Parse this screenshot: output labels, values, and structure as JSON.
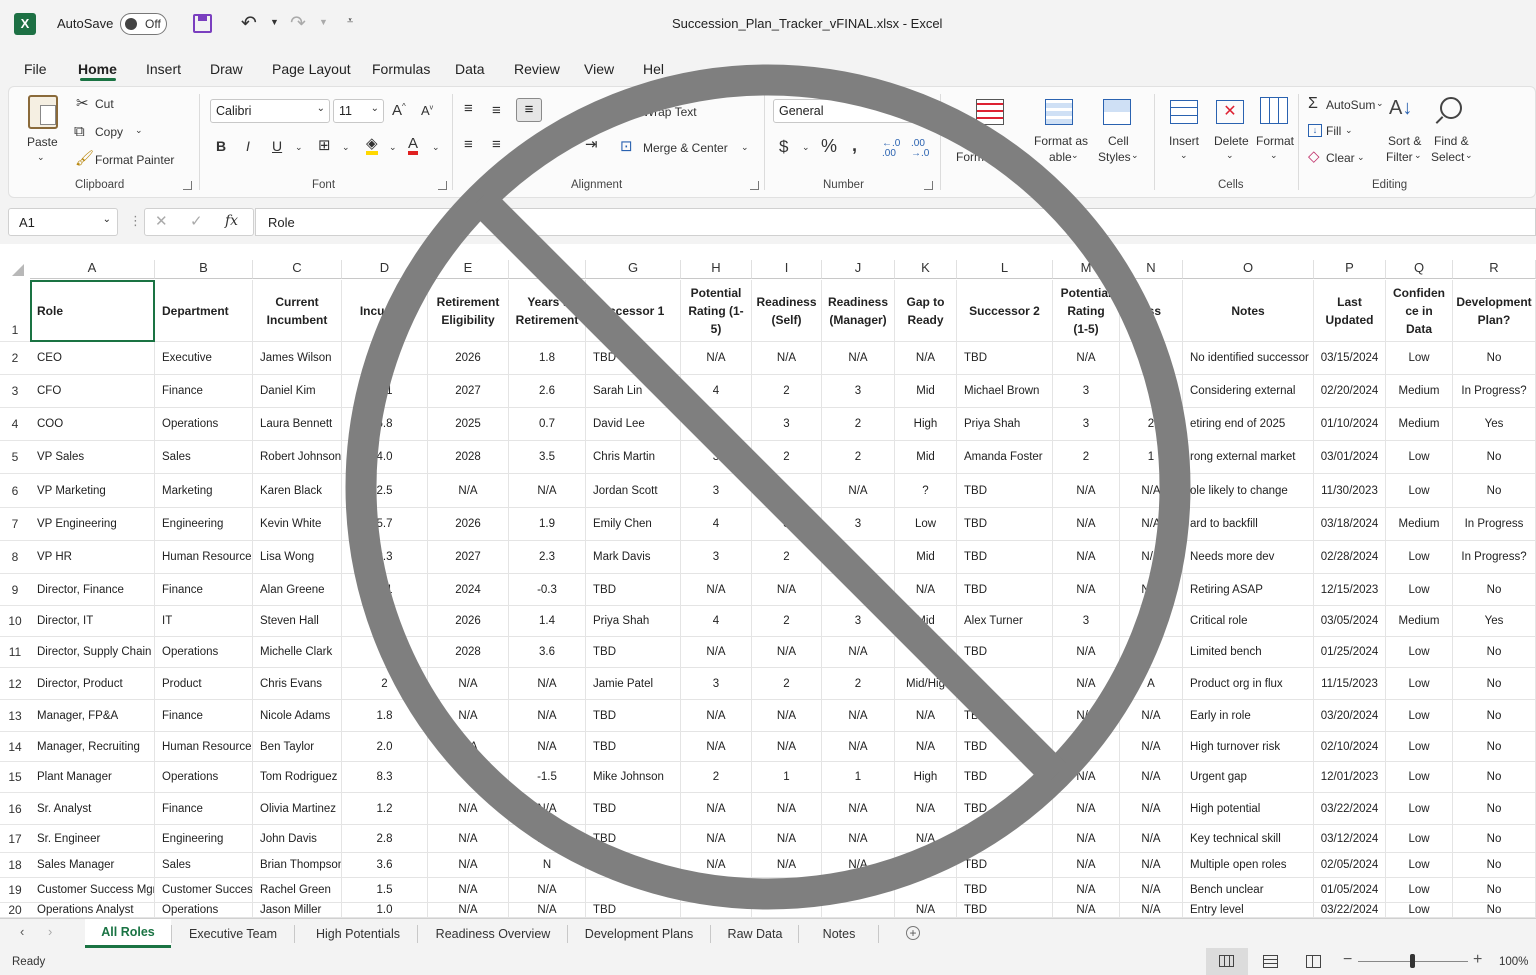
{
  "app": {
    "title": "Succession_Plan_Tracker_vFINAL.xlsx - Excel",
    "autosave_label": "AutoSave",
    "autosave_state": "Off",
    "accent": "#1a7343"
  },
  "menu": {
    "items": [
      "File",
      "Home",
      "Insert",
      "Draw",
      "Page Layout",
      "Formulas",
      "Data",
      "Review",
      "View",
      "Hel"
    ],
    "active": "Home"
  },
  "ribbon": {
    "clipboard": {
      "paste": "Paste",
      "cut": "Cut",
      "copy": "Copy",
      "format_painter": "Format Painter",
      "group": "Clipboard"
    },
    "font": {
      "name": "Calibri",
      "size": "11",
      "group": "Font"
    },
    "alignment": {
      "wrap": "Wrap Text",
      "merge": "Merge & Center",
      "group": "Alignment"
    },
    "number": {
      "format": "General",
      "group": "Number"
    },
    "styles": {
      "cond1": "Con",
      "cond2": "Formatti",
      "fmt_table1": "Format as",
      "fmt_table2": "able",
      "cell_styles1": "Cell",
      "cell_styles2": "Styles"
    },
    "cells": {
      "insert": "Insert",
      "delete": "Delete",
      "format": "Format",
      "group": "Cells"
    },
    "editing": {
      "autosum": "AutoSum",
      "fill": "Fill",
      "clear": "Clear",
      "sort1": "Sort &",
      "sort2": "Filter",
      "find1": "Find &",
      "find2": "Select",
      "group": "Editing"
    }
  },
  "formula_bar": {
    "name_box": "A1",
    "fx": "fx",
    "value": "Role"
  },
  "grid": {
    "columns": [
      "A",
      "B",
      "C",
      "D",
      "E",
      "",
      "G",
      "H",
      "I",
      "J",
      "K",
      "L",
      "M",
      "N",
      "O",
      "P",
      "Q",
      "R"
    ],
    "header_row": [
      "Role",
      "Department",
      "Current Incumbent",
      "Incu T s)",
      "Retirement Eligibility",
      "Years t Retirement",
      "uccessor 1",
      "Potential Rating (1-5)",
      "Readiness (Self)",
      "Readiness (Manager)",
      "Gap to Ready",
      "Successor 2",
      "Potential Rating (1-5)",
      "ess",
      "Notes",
      "Last Updated",
      "Confiden ce in Data",
      "Development Plan?"
    ],
    "rows": [
      [
        "2",
        "CEO",
        "Executive",
        "James Wilson",
        "2",
        "2026",
        "1.8",
        "TBD",
        "N/A",
        "N/A",
        "N/A",
        "N/A",
        "TBD",
        "N/A",
        "N/",
        "No identified successor",
        "03/15/2024",
        "Low",
        "No"
      ],
      [
        "3",
        "CFO",
        "Finance",
        "Daniel Kim",
        "3.1",
        "2027",
        "2.6",
        "Sarah Lin",
        "4",
        "2",
        "3",
        "Mid",
        "Michael Brown",
        "3",
        "1",
        "Considering external",
        "02/20/2024",
        "Medium",
        "In Progress?"
      ],
      [
        "4",
        "COO",
        "Operations",
        "Laura Bennett",
        "6.8",
        "2025",
        "0.7",
        "David Lee",
        "",
        "3",
        "2",
        "High",
        "Priya Shah",
        "3",
        "2",
        "etiring end of 2025",
        "01/10/2024",
        "Medium",
        "Yes"
      ],
      [
        "5",
        "VP Sales",
        "Sales",
        "Robert Johnson",
        "4.0",
        "2028",
        "3.5",
        "Chris Martin",
        "3",
        "2",
        "2",
        "Mid",
        "Amanda Foster",
        "2",
        "1",
        "rong external market",
        "03/01/2024",
        "Low",
        "No"
      ],
      [
        "6",
        "VP Marketing",
        "Marketing",
        "Karen Black",
        "2.5",
        "N/A",
        "N/A",
        "Jordan Scott",
        "3",
        "",
        "N/A",
        "?",
        "TBD",
        "N/A",
        "N/A",
        "ole likely to change",
        "11/30/2023",
        "Low",
        "No"
      ],
      [
        "7",
        "VP Engineering",
        "Engineering",
        "Kevin White",
        "5.7",
        "2026",
        "1.9",
        "Emily Chen",
        "4",
        "3",
        "3",
        "Low",
        "TBD",
        "N/A",
        "N/A",
        "ard to backfill",
        "03/18/2024",
        "Medium",
        "In Progress"
      ],
      [
        "8",
        "VP HR",
        "Human Resources",
        "Lisa Wong",
        "3.3",
        "2027",
        "2.3",
        "Mark Davis",
        "3",
        "2",
        "",
        "Mid",
        "TBD",
        "N/A",
        "N/A",
        "Needs more dev",
        "02/28/2024",
        "Low",
        "In Progress?"
      ],
      [
        "9",
        "Director, Finance",
        "Finance",
        "Alan Greene",
        "7.1",
        "2024",
        "-0.3",
        "TBD",
        "N/A",
        "N/A",
        "N",
        "N/A",
        "TBD",
        "N/A",
        "N/A",
        "Retiring ASAP",
        "12/15/2023",
        "Low",
        "No"
      ],
      [
        "10",
        "Director, IT",
        "IT",
        "Steven Hall",
        "6",
        "2026",
        "1.4",
        "Priya Shah",
        "4",
        "2",
        "3",
        "Mid",
        "Alex Turner",
        "3",
        "2",
        "Critical role",
        "03/05/2024",
        "Medium",
        "Yes"
      ],
      [
        "11",
        "Director, Supply Chain",
        "Operations",
        "Michelle Clark",
        "",
        "2028",
        "3.6",
        "TBD",
        "N/A",
        "N/A",
        "N/A",
        "",
        "TBD",
        "N/A",
        "",
        "Limited bench",
        "01/25/2024",
        "Low",
        "No"
      ],
      [
        "12",
        "Director, Product",
        "Product",
        "Chris Evans",
        "2",
        "N/A",
        "N/A",
        "Jamie Patel",
        "3",
        "2",
        "2",
        "Mid/Hig",
        "",
        "N/A",
        "A",
        "Product org in flux",
        "11/15/2023",
        "Low",
        "No"
      ],
      [
        "13",
        "Manager, FP&A",
        "Finance",
        "Nicole Adams",
        "1.8",
        "N/A",
        "N/A",
        "TBD",
        "N/A",
        "N/A",
        "N/A",
        "N/A",
        "TB",
        "N/A",
        "N/A",
        "Early in role",
        "03/20/2024",
        "Low",
        "No"
      ],
      [
        "14",
        "Manager, Recruiting",
        "Human Resources",
        "Ben Taylor",
        "2.0",
        "N/A",
        "N/A",
        "TBD",
        "N/A",
        "N/A",
        "N/A",
        "N/A",
        "TBD",
        "N",
        "N/A",
        "High turnover risk",
        "02/10/2024",
        "Low",
        "No"
      ],
      [
        "15",
        "Plant Manager",
        "Operations",
        "Tom Rodriguez",
        "8.3",
        "",
        "-1.5",
        "Mike Johnson",
        "2",
        "1",
        "1",
        "High",
        "TBD",
        "N/A",
        "N/A",
        "Urgent gap",
        "12/01/2023",
        "Low",
        "No"
      ],
      [
        "16",
        "Sr. Analyst",
        "Finance",
        "Olivia Martinez",
        "1.2",
        "N/A",
        "N/A",
        "TBD",
        "N/A",
        "N/A",
        "N/A",
        "N/A",
        "TBD",
        "N/A",
        "N/A",
        "High potential",
        "03/22/2024",
        "Low",
        "No"
      ],
      [
        "17",
        "Sr. Engineer",
        "Engineering",
        "John Davis",
        "2.8",
        "N/A",
        "N/A",
        "TBD",
        "N/A",
        "N/A",
        "N/A",
        "N/A",
        "TB",
        "N/A",
        "N/A",
        "Key technical skill",
        "03/12/2024",
        "Low",
        "No"
      ],
      [
        "18",
        "Sales Manager",
        "Sales",
        "Brian Thompson",
        "3.6",
        "N/A",
        "N",
        "",
        "N/A",
        "N/A",
        "N/A",
        "N/",
        "TBD",
        "N/A",
        "N/A",
        "Multiple open roles",
        "02/05/2024",
        "Low",
        "No"
      ],
      [
        "19",
        "Customer Success Mgr",
        "Customer Success",
        "Rachel Green",
        "1.5",
        "N/A",
        "N/A",
        "",
        "N/A",
        "N/A",
        "N",
        "",
        "TBD",
        "N/A",
        "N/A",
        "Bench unclear",
        "01/05/2024",
        "Low",
        "No"
      ],
      [
        "20",
        "Operations Analyst",
        "Operations",
        "Jason Miller",
        "1.0",
        "N/A",
        "N/A",
        "TBD",
        "",
        "",
        "",
        "N/A",
        "TBD",
        "N/A",
        "N/A",
        "Entry level",
        "03/22/2024",
        "Low",
        "No"
      ]
    ]
  },
  "sheet_tabs": {
    "items": [
      "All Roles",
      "Executive Team",
      "High Potentials",
      "Readiness Overview",
      "Development Plans",
      "Raw Data",
      "Notes"
    ],
    "active": "All Roles"
  },
  "status": {
    "ready": "Ready",
    "zoom": "100%"
  },
  "overlay": {
    "icon": "prohibited-icon",
    "color": "#7f7f7f"
  }
}
